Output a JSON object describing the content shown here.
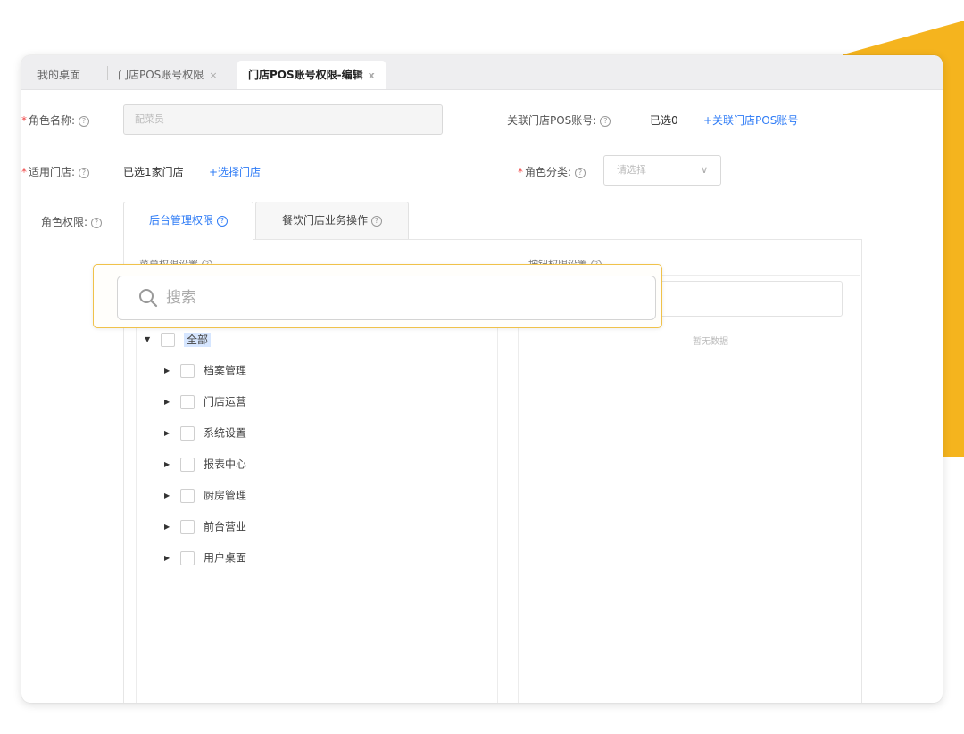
{
  "tabs": [
    {
      "label": "我的桌面"
    },
    {
      "label": "门店POS账号权限",
      "close": "×"
    },
    {
      "label": "门店POS账号权限-编辑",
      "close": "x"
    }
  ],
  "form": {
    "role_name_label": "角色名称:",
    "role_name_placeholder": "配菜员",
    "link_pos_label": "关联门店POS账号:",
    "link_pos_value": "已选0",
    "link_pos_action": "+关联门店POS账号",
    "store_label": "适用门店:",
    "store_value": "已选1家门店",
    "store_action": "+选择门店",
    "role_category_label": "角色分类:",
    "role_category_placeholder": "请选择",
    "role_perm_label": "角色权限:",
    "help_glyph": "?",
    "required_mark": "*",
    "chevron": "∨"
  },
  "perm_tabs": [
    {
      "label": "后台管理权限",
      "active": true
    },
    {
      "label": "餐饮门店业务操作",
      "active": false
    }
  ],
  "menu_perm_title": "菜单权限设置",
  "button_perm_title": "按钮权限设置",
  "search": {
    "placeholder": "搜索"
  },
  "empty_text": "暂无数据",
  "tree": {
    "root": {
      "label": "全部"
    },
    "children": [
      "档案管理",
      "门店运营",
      "系统设置",
      "报表中心",
      "厨房管理",
      "前台营业",
      "用户桌面"
    ]
  },
  "colors": {
    "accent": "#2f7cf6",
    "required": "#f04848",
    "highlight": "#f0c24a",
    "decor": "#f5b41e"
  }
}
